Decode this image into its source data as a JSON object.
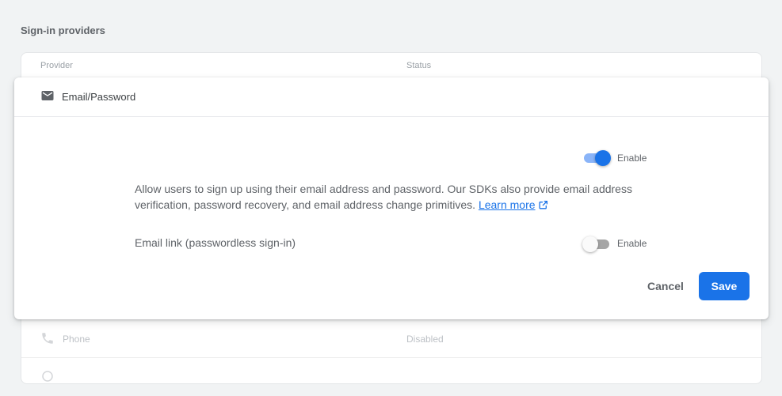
{
  "section": {
    "title": "Sign-in providers"
  },
  "table": {
    "columns": {
      "provider": "Provider",
      "status": "Status"
    },
    "rows": [
      {
        "name": "Phone",
        "status": "Disabled",
        "icon": "phone-icon"
      }
    ]
  },
  "dialog": {
    "title": "Email/Password",
    "icon": "mail-icon",
    "enable_toggle": {
      "label": "Enable",
      "state": "on"
    },
    "description": "Allow users to sign up using their email address and password. Our SDKs also provide email address verification, password recovery, and email address change primitives.",
    "learn_more": "Learn more",
    "email_link": {
      "label": "Email link (passwordless sign-in)",
      "toggle_label": "Enable",
      "state": "off"
    },
    "actions": {
      "cancel": "Cancel",
      "save": "Save"
    }
  },
  "colors": {
    "accent": "#1a73e8",
    "accent_light": "#8ab4f8",
    "background": "#f1f3f4"
  }
}
